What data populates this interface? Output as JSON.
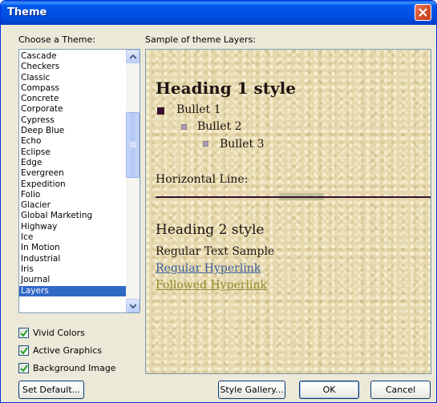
{
  "window": {
    "title": "Theme"
  },
  "theme_list": {
    "label": "Choose a Theme:",
    "items": [
      "Cascade",
      "Checkers",
      "Classic",
      "Compass",
      "Concrete",
      "Corporate",
      "Cypress",
      "Deep Blue",
      "Echo",
      "Eclipse",
      "Edge",
      "Evergreen",
      "Expedition",
      "Folio",
      "Glacier",
      "Global Marketing",
      "Highway",
      "Ice",
      "In Motion",
      "Industrial",
      "Iris",
      "Journal",
      "Layers"
    ],
    "selected": "Layers"
  },
  "options": {
    "vivid_colors": {
      "label": "Vivid Colors",
      "checked": true
    },
    "active_graphics": {
      "label": "Active Graphics",
      "checked": true
    },
    "background_image": {
      "label": "Background Image",
      "checked": true
    }
  },
  "preview": {
    "label": "Sample of theme Layers:",
    "heading1": "Heading 1 style",
    "bullet1": "Bullet 1",
    "bullet2": "Bullet 2",
    "bullet3": "Bullet 3",
    "hr_label": "Horizontal Line:",
    "heading2": "Heading 2 style",
    "regular_text": "Regular Text Sample",
    "hyperlink": "Regular Hyperlink",
    "followed_hyperlink": "Followed Hyperlink"
  },
  "buttons": {
    "set_default": "Set Default...",
    "style_gallery": "Style Gallery...",
    "ok": "OK",
    "cancel": "Cancel"
  },
  "colors": {
    "titlebar": "#0054e3",
    "selection": "#316ac5",
    "hyperlink": "#3b5c9c",
    "followed_hyperlink": "#8f8a2a",
    "bullet": "#3a1030"
  }
}
